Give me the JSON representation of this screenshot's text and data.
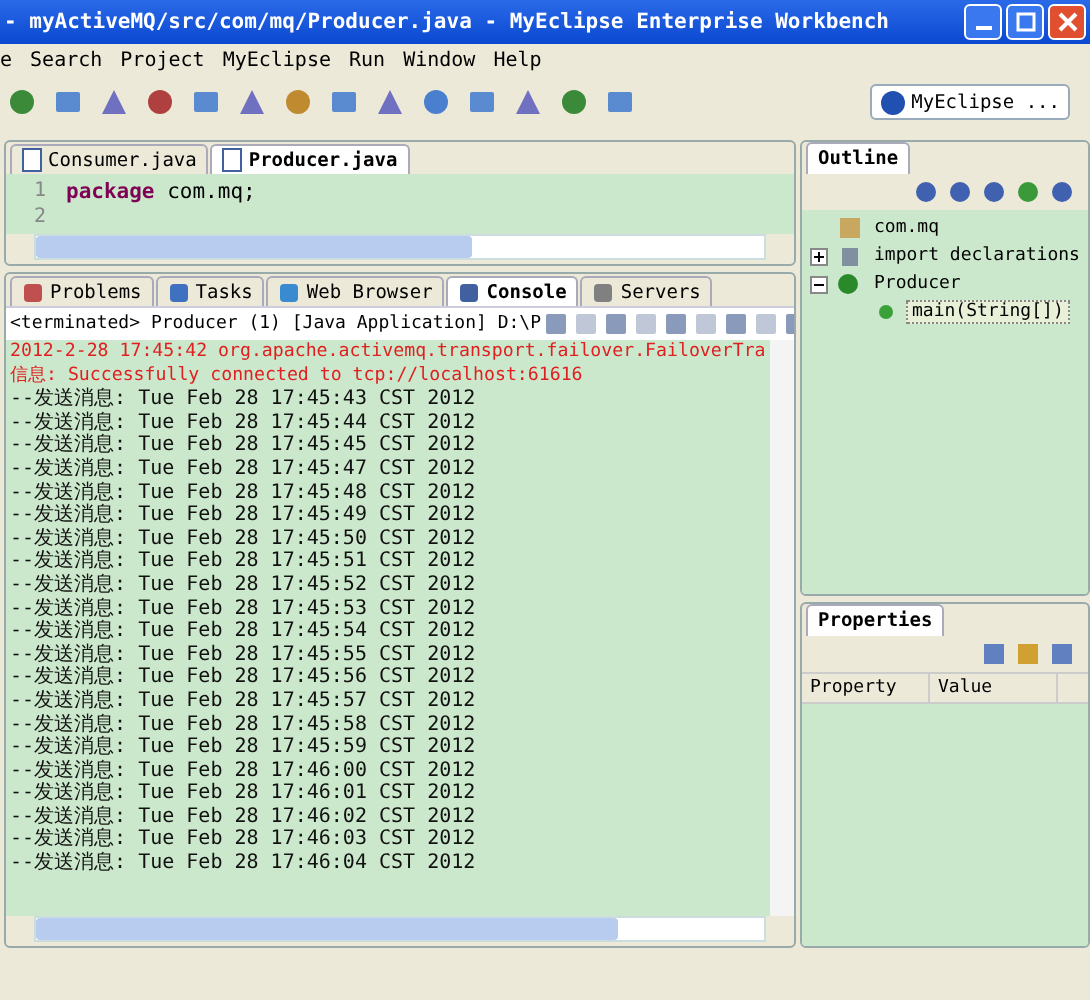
{
  "window": {
    "title": "- myActiveMQ/src/com/mq/Producer.java - MyEclipse Enterprise Workbench"
  },
  "menu": [
    "e",
    "Search",
    "Project",
    "MyEclipse",
    "Run",
    "Window",
    "Help"
  ],
  "perspective": {
    "label": "MyEclipse ..."
  },
  "editor": {
    "tabs": [
      {
        "label": "Consumer.java",
        "selected": false
      },
      {
        "label": "Producer.java",
        "selected": true
      }
    ],
    "lines": [
      {
        "number": "1",
        "keyword": "package",
        "text": " com.mq;"
      },
      {
        "number": "2"
      }
    ]
  },
  "console": {
    "tabs": [
      {
        "label": "Problems",
        "selected": false
      },
      {
        "label": "Tasks",
        "selected": false
      },
      {
        "label": "Web Browser",
        "selected": false
      },
      {
        "label": "Console",
        "selected": true
      },
      {
        "label": "Servers",
        "selected": false
      }
    ],
    "header": "<terminated> Producer (1) [Java Application] D:\\P",
    "lines": [
      {
        "kind": "error",
        "text": "2012-2-28 17:45:42 org.apache.activemq.transport.failover.FailoverTra"
      },
      {
        "kind": "error",
        "text": "信息: Successfully connected to tcp://localhost:61616"
      },
      {
        "kind": "output",
        "text": "--发送消息: Tue Feb 28 17:45:43 CST 2012"
      },
      {
        "kind": "output",
        "text": "--发送消息: Tue Feb 28 17:45:44 CST 2012"
      },
      {
        "kind": "output",
        "text": "--发送消息: Tue Feb 28 17:45:45 CST 2012"
      },
      {
        "kind": "output",
        "text": "--发送消息: Tue Feb 28 17:45:47 CST 2012"
      },
      {
        "kind": "output",
        "text": "--发送消息: Tue Feb 28 17:45:48 CST 2012"
      },
      {
        "kind": "output",
        "text": "--发送消息: Tue Feb 28 17:45:49 CST 2012"
      },
      {
        "kind": "output",
        "text": "--发送消息: Tue Feb 28 17:45:50 CST 2012"
      },
      {
        "kind": "output",
        "text": "--发送消息: Tue Feb 28 17:45:51 CST 2012"
      },
      {
        "kind": "output",
        "text": "--发送消息: Tue Feb 28 17:45:52 CST 2012"
      },
      {
        "kind": "output",
        "text": "--发送消息: Tue Feb 28 17:45:53 CST 2012"
      },
      {
        "kind": "output",
        "text": "--发送消息: Tue Feb 28 17:45:54 CST 2012"
      },
      {
        "kind": "output",
        "text": "--发送消息: Tue Feb 28 17:45:55 CST 2012"
      },
      {
        "kind": "output",
        "text": "--发送消息: Tue Feb 28 17:45:56 CST 2012"
      },
      {
        "kind": "output",
        "text": "--发送消息: Tue Feb 28 17:45:57 CST 2012"
      },
      {
        "kind": "output",
        "text": "--发送消息: Tue Feb 28 17:45:58 CST 2012"
      },
      {
        "kind": "output",
        "text": "--发送消息: Tue Feb 28 17:45:59 CST 2012"
      },
      {
        "kind": "output",
        "text": "--发送消息: Tue Feb 28 17:46:00 CST 2012"
      },
      {
        "kind": "output",
        "text": "--发送消息: Tue Feb 28 17:46:01 CST 2012"
      },
      {
        "kind": "output",
        "text": "--发送消息: Tue Feb 28 17:46:02 CST 2012"
      },
      {
        "kind": "output",
        "text": "--发送消息: Tue Feb 28 17:46:03 CST 2012"
      },
      {
        "kind": "output",
        "text": "--发送消息: Tue Feb 28 17:46:04 CST 2012"
      }
    ]
  },
  "outline": {
    "title": "Outline",
    "tree": [
      {
        "kind": "package",
        "label": "com.mq",
        "selected": false
      },
      {
        "kind": "imports",
        "label": "import declarations",
        "expanded": false,
        "selected": false
      },
      {
        "kind": "class",
        "label": "Producer",
        "expanded": true,
        "selected": false,
        "children": [
          {
            "kind": "method",
            "label": "main(String[])",
            "selected": true
          }
        ]
      }
    ]
  },
  "properties": {
    "title": "Properties",
    "columns": [
      "Property",
      "Value"
    ]
  }
}
